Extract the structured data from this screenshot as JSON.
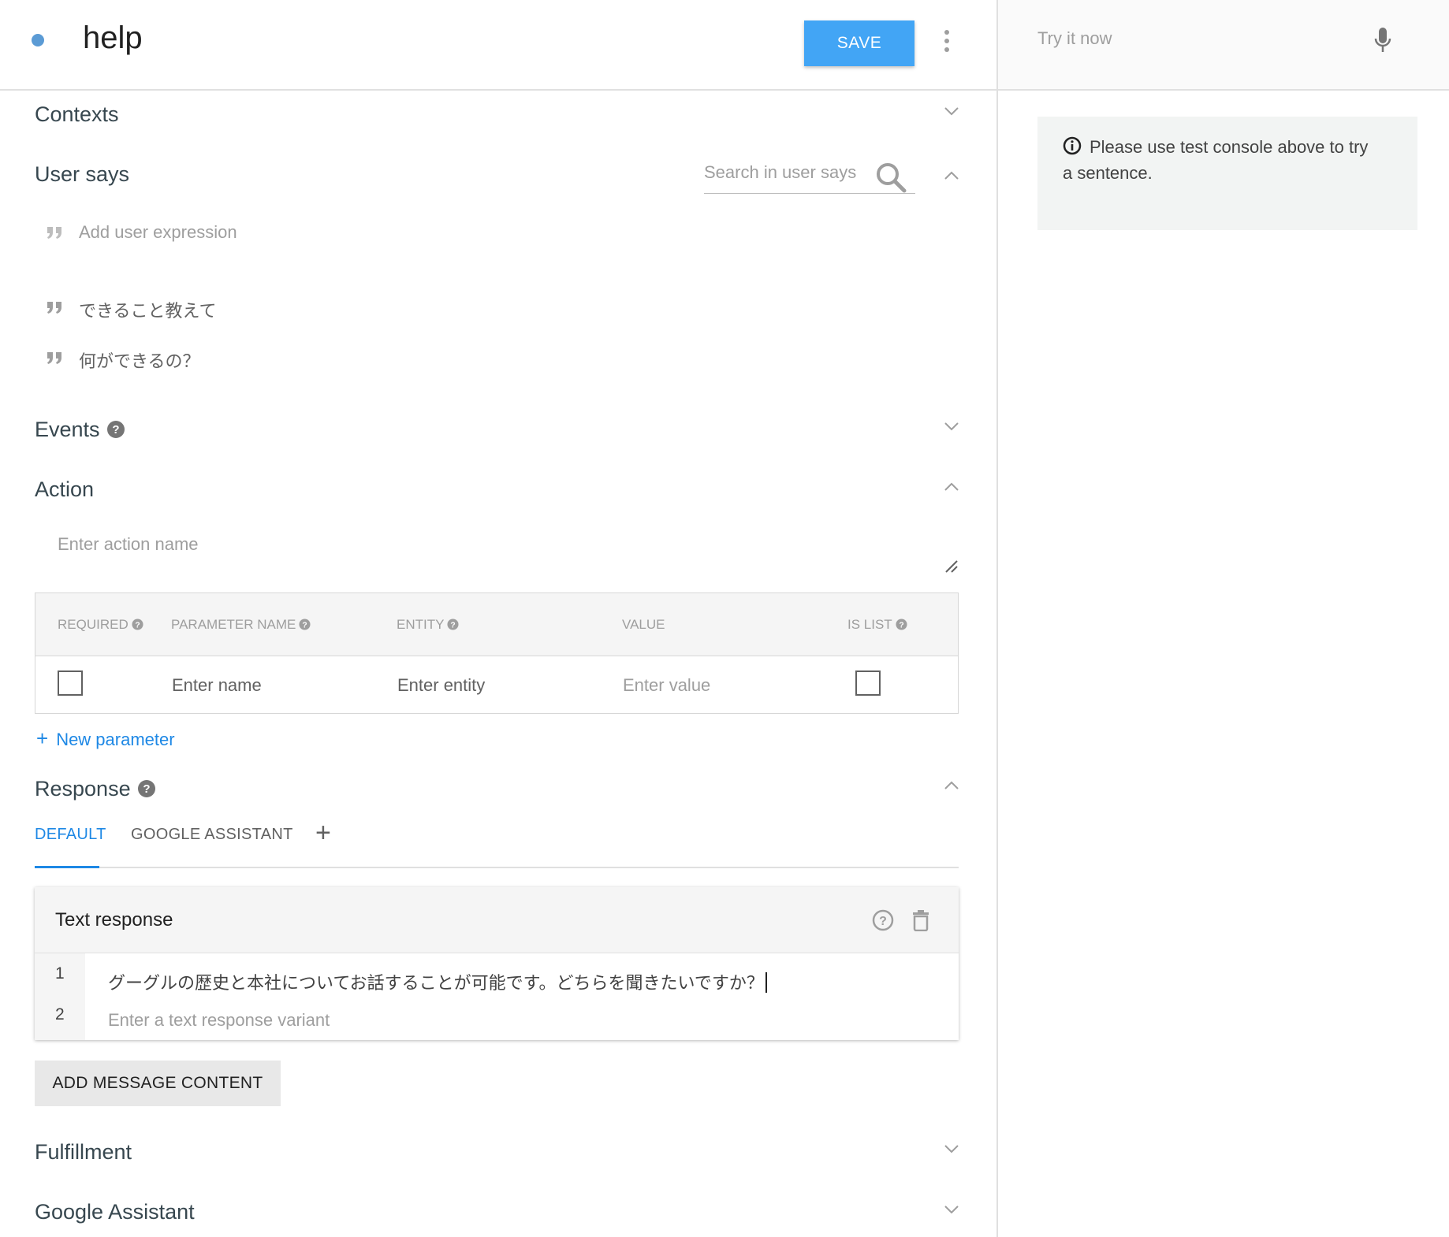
{
  "header": {
    "intent_name": "help",
    "save_label": "SAVE"
  },
  "sections": {
    "contexts": "Contexts",
    "user_says": "User says",
    "events": "Events",
    "action": "Action",
    "response": "Response",
    "fulfillment": "Fulfillment",
    "google_assistant": "Google Assistant"
  },
  "user_says": {
    "search_placeholder": "Search in user says",
    "add_placeholder": "Add user expression",
    "expressions": [
      "できること教えて",
      "何ができるの？"
    ]
  },
  "action": {
    "name_placeholder": "Enter action name"
  },
  "parameters": {
    "headers": {
      "required": "REQUIRED",
      "parameter_name": "PARAMETER NAME",
      "entity": "ENTITY",
      "value": "VALUE",
      "is_list": "IS LIST"
    },
    "row": {
      "name_placeholder": "Enter name",
      "entity_placeholder": "Enter entity",
      "value_placeholder": "Enter value"
    },
    "new_parameter": "New parameter"
  },
  "response": {
    "tabs": [
      "DEFAULT",
      "GOOGLE ASSISTANT"
    ],
    "add_tab_symbol": "+",
    "card_title": "Text response",
    "lines": [
      {
        "number": "1",
        "text": "グーグルの歴史と本社についてお話することが可能です。どちらを聞きたいですか？"
      },
      {
        "number": "2",
        "placeholder": "Enter a text response variant"
      }
    ],
    "add_message_content": "ADD MESSAGE CONTENT"
  },
  "test_console": {
    "placeholder": "Try it now",
    "info_message": "Please use test console above to try a sentence."
  },
  "icons": {
    "kebab": "more-vertical-icon",
    "search": "search-icon",
    "chevron_down": "chevron-down-icon",
    "chevron_up": "chevron-up-icon",
    "quote": "quote-icon",
    "help": "help-circle-icon",
    "trash": "trash-icon",
    "microphone": "microphone-icon",
    "info": "info-icon"
  },
  "colors": {
    "accent": "#1e88e5",
    "save_button": "#42a5f5",
    "status_dot": "#5b9bd5"
  }
}
